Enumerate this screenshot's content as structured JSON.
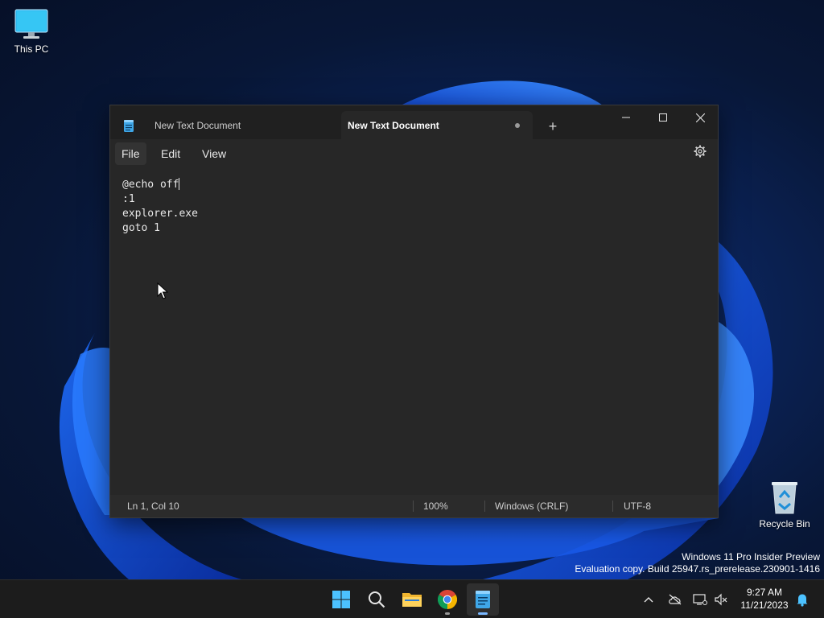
{
  "desktop": {
    "icons": [
      {
        "label": "This PC"
      },
      {
        "label": "Recycle Bin"
      }
    ],
    "watermark": {
      "line1": "Windows 11 Pro Insider Preview",
      "line2": "Evaluation copy. Build 25947.rs_prerelease.230901-1416"
    }
  },
  "notepad": {
    "tabs": [
      {
        "title": "New Text Document",
        "active": false
      },
      {
        "title": "New Text Document",
        "active": true,
        "unsaved": true
      }
    ],
    "new_tab_label": "+",
    "menu": {
      "file": "File",
      "edit": "Edit",
      "view": "View"
    },
    "content_lines": [
      "@echo off",
      ":1",
      "explorer.exe",
      "goto 1"
    ],
    "status": {
      "position": "Ln 1, Col 10",
      "zoom": "100%",
      "line_ending": "Windows (CRLF)",
      "encoding": "UTF-8"
    }
  },
  "taskbar": {
    "apps": [
      "start-icon",
      "search-icon",
      "file-explorer-icon",
      "chrome-icon",
      "notepad-icon"
    ],
    "clock": {
      "time": "9:27 AM",
      "date": "11/21/2023"
    }
  },
  "colors": {
    "accent": "#4cc2ff",
    "window_bg": "#272727",
    "titlebar_bg": "#202020",
    "taskbar_bg": "#1c1c1c"
  }
}
